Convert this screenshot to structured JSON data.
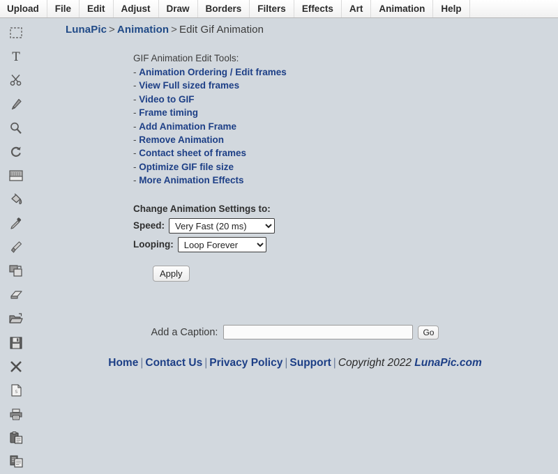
{
  "menubar": {
    "items": [
      {
        "label": "Upload",
        "name": "menu-upload"
      },
      {
        "label": "File",
        "name": "menu-file"
      },
      {
        "label": "Edit",
        "name": "menu-edit"
      },
      {
        "label": "Adjust",
        "name": "menu-adjust"
      },
      {
        "label": "Draw",
        "name": "menu-draw"
      },
      {
        "label": "Borders",
        "name": "menu-borders"
      },
      {
        "label": "Filters",
        "name": "menu-filters"
      },
      {
        "label": "Effects",
        "name": "menu-effects"
      },
      {
        "label": "Art",
        "name": "menu-art"
      },
      {
        "label": "Animation",
        "name": "menu-animation"
      },
      {
        "label": "Help",
        "name": "menu-help"
      }
    ]
  },
  "sidebar": {
    "tools": [
      {
        "icon": "selection-marquee-icon"
      },
      {
        "icon": "text-tool-icon"
      },
      {
        "icon": "scissors-crop-icon"
      },
      {
        "icon": "pencil-icon"
      },
      {
        "icon": "magnifier-zoom-icon"
      },
      {
        "icon": "rotate-refresh-icon"
      },
      {
        "icon": "eraser-block-icon"
      },
      {
        "icon": "paint-bucket-icon"
      },
      {
        "icon": "eyedropper-icon"
      },
      {
        "icon": "paint-brush-icon"
      },
      {
        "icon": "layers-copy-icon"
      },
      {
        "icon": "eraser-icon"
      },
      {
        "icon": "open-folder-icon"
      },
      {
        "icon": "save-floppy-icon"
      },
      {
        "icon": "close-x-icon"
      },
      {
        "icon": "new-document-icon"
      },
      {
        "icon": "print-icon"
      },
      {
        "icon": "clipboard-paste-icon"
      },
      {
        "icon": "copy-pages-icon"
      }
    ]
  },
  "breadcrumb": {
    "root": "LunaPic",
    "sep1": ">",
    "section": "Animation",
    "sep2": ">",
    "current": "Edit Gif Animation"
  },
  "tools_panel": {
    "heading": "GIF Animation Edit Tools:",
    "dash": "-",
    "links": [
      "Animation Ordering / Edit frames",
      "View Full sized frames",
      "Video to GIF",
      "Frame timing",
      "Add Animation Frame",
      "Remove Animation",
      "Contact sheet of frames",
      "Optimize GIF file size",
      "More Animation Effects"
    ]
  },
  "settings": {
    "heading": "Change Animation Settings to:",
    "speed_label": "Speed:",
    "speed_value": "Very Fast (20 ms)",
    "speed_options": [
      "Very Fast (20 ms)"
    ],
    "looping_label": "Looping:",
    "looping_value": "Loop Forever",
    "looping_options": [
      "Loop Forever"
    ],
    "apply_label": "Apply"
  },
  "caption": {
    "label": "Add a Caption:",
    "value": "",
    "placeholder": "",
    "go_label": "Go"
  },
  "footer": {
    "home": "Home",
    "contact": "Contact Us",
    "privacy": "Privacy Policy",
    "support": "Support",
    "pipe": "|",
    "copyright_text": "Copyright 2022 ",
    "brand": "LunaPic.com"
  },
  "colors": {
    "background": "#d2d8de",
    "link": "#1d3f86",
    "menu_text": "#2b2b2b",
    "body_text": "#3d3d3d"
  }
}
